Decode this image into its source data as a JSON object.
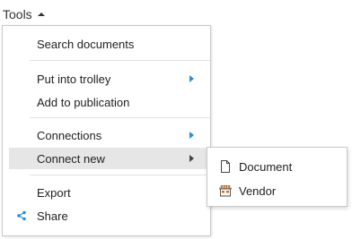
{
  "toolbar": {
    "tools_label": "Tools"
  },
  "menu": {
    "search_documents": "Search documents",
    "put_into_trolley": "Put into trolley",
    "add_to_publication": "Add to publication",
    "connections": "Connections",
    "connect_new": "Connect new",
    "export": "Export",
    "share": "Share"
  },
  "submenu": {
    "document": "Document",
    "vendor": "Vendor"
  },
  "colors": {
    "accent": "#2b8fd6",
    "active_background": "#e6e6e6",
    "vendor_icon": "#c1722a"
  }
}
